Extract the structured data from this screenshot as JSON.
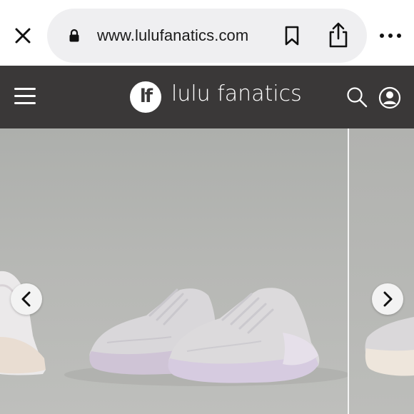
{
  "browser": {
    "url": "www.lulufanatics.com",
    "icons": [
      "close-icon",
      "lock-icon",
      "bookmark-icon",
      "share-icon",
      "more-icon"
    ]
  },
  "site_header": {
    "logo_text": "lf",
    "brand_name": "lulu fanatics",
    "icons": [
      "menu-icon",
      "search-icon",
      "account-icon"
    ]
  },
  "carousel": {
    "icons": [
      "chevron-left-icon",
      "chevron-right-icon"
    ]
  },
  "colors": {
    "header_bg": "#3a3838",
    "url_pill_bg": "#efeff1",
    "photo_bg": "#b3b4b1"
  }
}
